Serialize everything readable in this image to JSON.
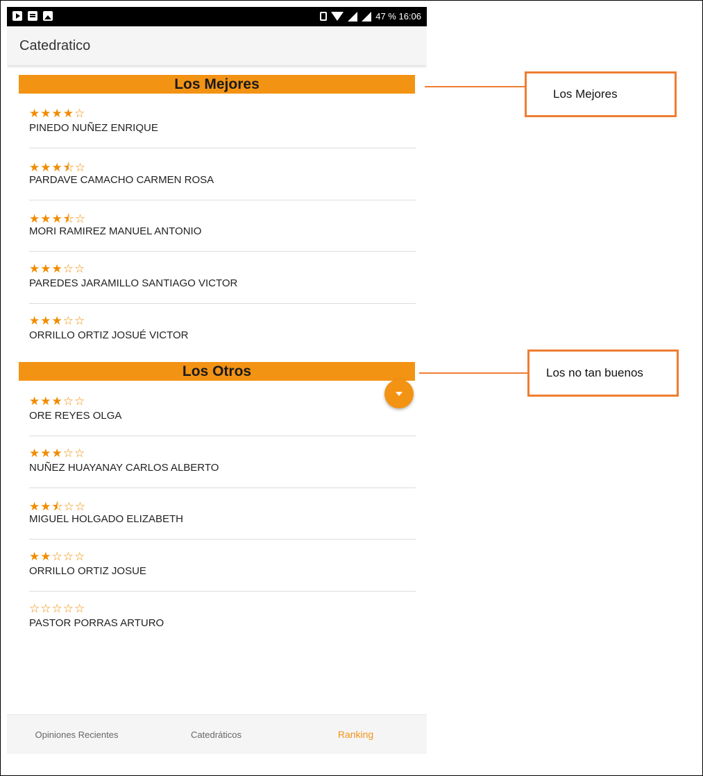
{
  "status_bar": {
    "battery_time": "47 % 16:06"
  },
  "app_bar": {
    "title": "Catedratico"
  },
  "sections": [
    {
      "title": "Los Mejores",
      "items": [
        {
          "name": "PINEDO NUÑEZ ENRIQUE",
          "stars": "★★★★☆",
          "rating": 4
        },
        {
          "name": "PARDAVE CAMACHO CARMEN ROSA",
          "stars": "★★★⯪☆",
          "rating": 3.5
        },
        {
          "name": "MORI RAMIREZ MANUEL ANTONIO",
          "stars": "★★★⯪☆",
          "rating": 3.5
        },
        {
          "name": "PAREDES JARAMILLO SANTIAGO VICTOR",
          "stars": "★★★☆☆",
          "rating": 3
        },
        {
          "name": "ORRILLO ORTIZ JOSUÉ VICTOR",
          "stars": "★★★☆☆",
          "rating": 3
        }
      ]
    },
    {
      "title": "Los Otros",
      "items": [
        {
          "name": "ORE REYES OLGA",
          "stars": "★★★☆☆",
          "rating": 3
        },
        {
          "name": "NUÑEZ HUAYANAY CARLOS ALBERTO",
          "stars": "★★★☆☆",
          "rating": 3
        },
        {
          "name": "MIGUEL HOLGADO ELIZABETH",
          "stars": "★★⯪☆☆",
          "rating": 2.5
        },
        {
          "name": "ORRILLO ORTIZ JOSUE",
          "stars": "★★☆☆☆",
          "rating": 2
        },
        {
          "name": "PASTOR PORRAS ARTURO",
          "stars": "☆☆☆☆☆",
          "rating": 0
        }
      ]
    }
  ],
  "bottom_nav": {
    "tabs": [
      {
        "label": "Opiniones Recientes",
        "active": false
      },
      {
        "label": "Catedráticos",
        "active": false
      },
      {
        "label": "Ranking",
        "active": true
      }
    ]
  },
  "annotations": [
    {
      "text": "Los Mejores"
    },
    {
      "text": "Los no tan buenos"
    }
  ],
  "colors": {
    "accent": "#f39314",
    "annotation": "#ef7d31"
  }
}
